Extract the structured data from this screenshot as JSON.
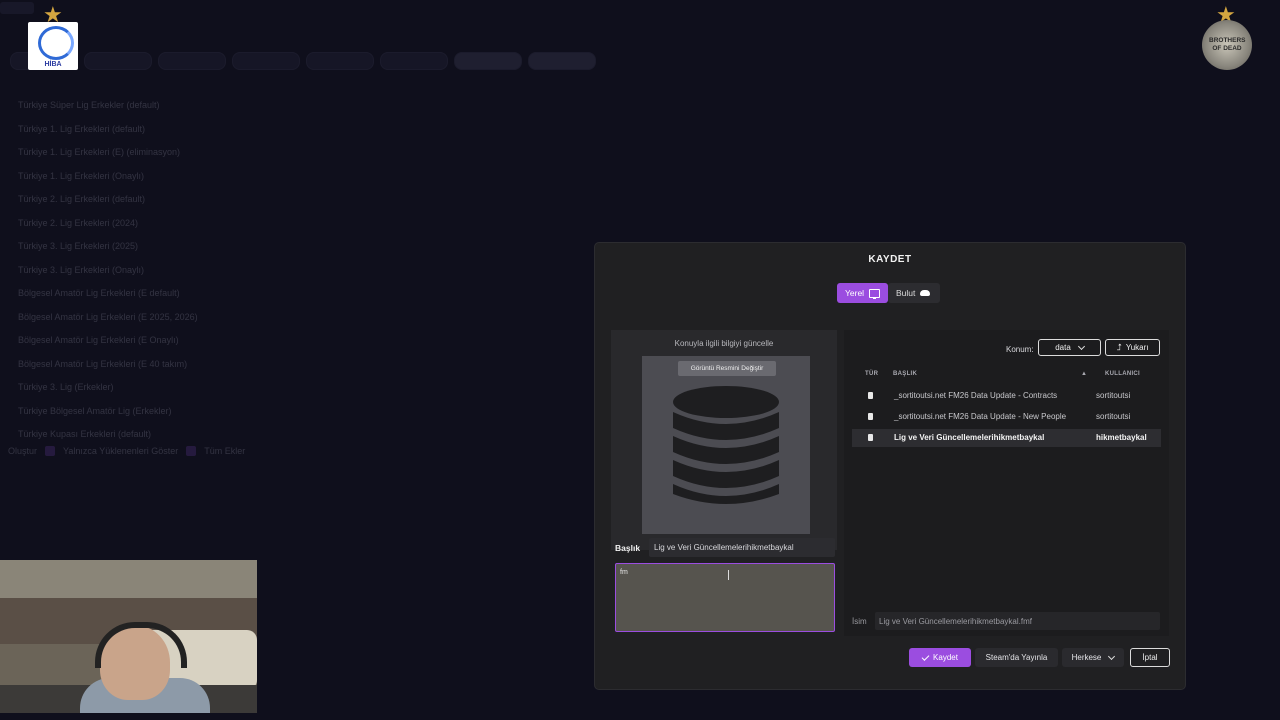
{
  "background": {
    "list_items": [
      "Türkiye Süper Lig Erkekler (default)",
      "Türkiye 1. Lig Erkekleri (default)",
      "Türkiye 1. Lig Erkekleri (E) (eliminasyon)",
      "Türkiye 1. Lig Erkekleri (Onaylı)",
      "Türkiye 2. Lig Erkekleri (default)",
      "Türkiye 2. Lig Erkekleri (2024)",
      "Türkiye 3. Lig Erkekleri (2025)",
      "Türkiye 3. Lig Erkekleri (Onaylı)",
      "Bölgesel Amatör Lig Erkekleri (E default)",
      "Bölgesel Amatör Lig Erkekleri (E 2025, 2026)",
      "Bölgesel Amatör Lig Erkekleri (E Onaylı)",
      "Bölgesel Amatör Lig Erkekleri (E 40 takım)",
      "Türkiye 3. Lig (Erkekler)",
      "Türkiye Bölgesel Amatör Lig (Erkekler)",
      "Türkiye Kupası Erkekleri (default)"
    ],
    "filter_label_1": "Oluştur",
    "filter_label_2": "Yalnızca Yüklenenleri Göster",
    "filter_label_3": "Tüm Ekler"
  },
  "logos": {
    "left_text": "HİBA",
    "right_text": "BROTHERS OF DEAD"
  },
  "dialog": {
    "title": "KAYDET",
    "tabs": {
      "local": "Yerel",
      "cloud": "Bulut"
    },
    "left": {
      "caption": "Konuyla ilgili bilgiyi güncelle",
      "change_image": "Görüntü Resmini Değiştir",
      "title_label": "Başlık",
      "title_value": "Lig ve Veri Güncellemelerihikmetbaykal",
      "description_value": "fm"
    },
    "right": {
      "location_label": "Konum:",
      "location_value": "data",
      "up_label": "Yukarı",
      "columns": {
        "type": "TÜR",
        "title": "BAŞLIK",
        "user": "KULLANICI"
      },
      "files": [
        {
          "name": "_sortitoutsi.net FM26 Data Update - Contracts",
          "user": "sortitoutsi",
          "selected": false
        },
        {
          "name": "_sortitoutsi.net FM26 Data Update - New People",
          "user": "sortitoutsi",
          "selected": false
        },
        {
          "name": "Lig ve Veri Güncellemelerihikmetbaykal",
          "user": "hikmetbaykal",
          "selected": true
        }
      ],
      "name_label": "İsim",
      "name_value": "Lig ve Veri Güncellemelerihikmetbaykal.fmf"
    },
    "footer": {
      "save": "Kaydet",
      "steam": "Steam'da Yayınla",
      "visibility": "Herkese",
      "cancel": "İptal"
    }
  },
  "colors": {
    "accent": "#9b4de0",
    "dialog_bg": "#202022",
    "page_bg": "#0f0f1c"
  }
}
